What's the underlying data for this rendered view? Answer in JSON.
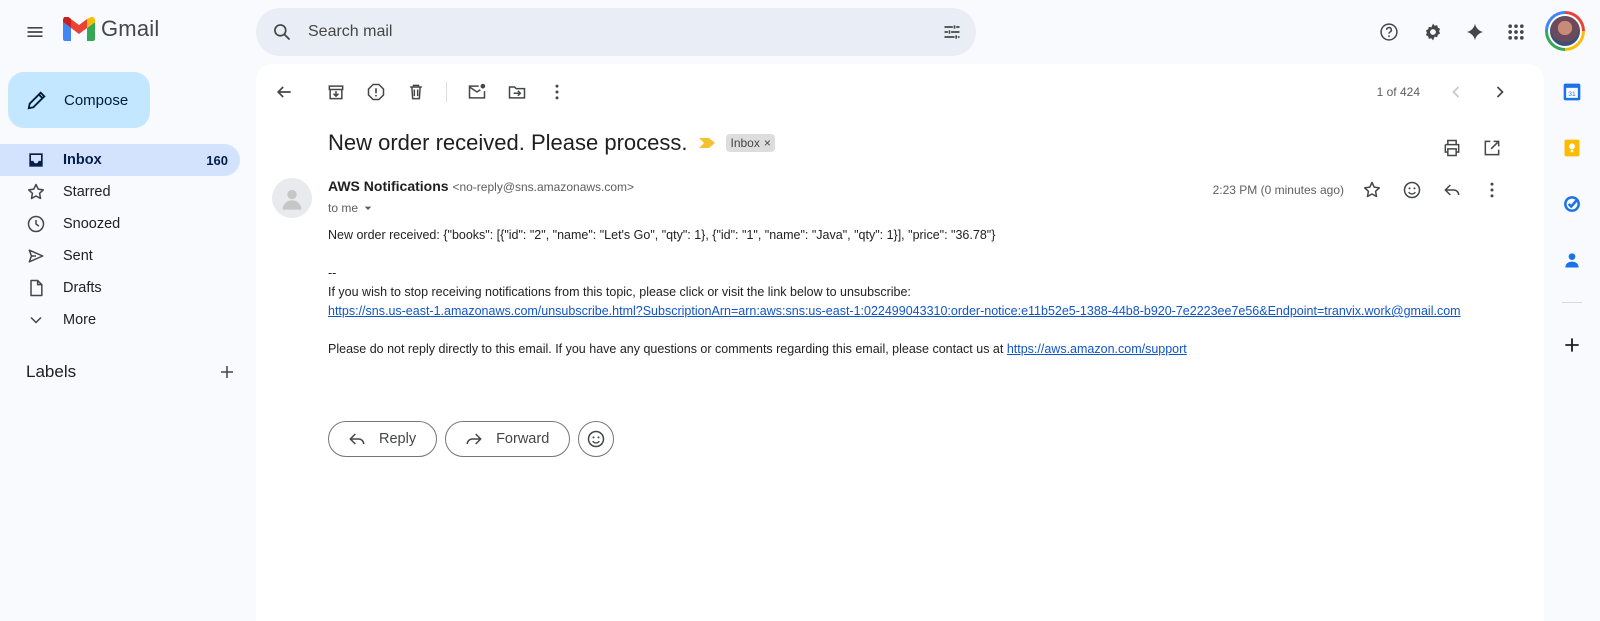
{
  "app": {
    "name": "Gmail"
  },
  "search": {
    "placeholder": "Search mail"
  },
  "compose": {
    "label": "Compose"
  },
  "nav": {
    "items": [
      {
        "label": "Inbox",
        "count": "160",
        "icon": "inbox-icon",
        "active": true
      },
      {
        "label": "Starred",
        "count": "",
        "icon": "star-icon"
      },
      {
        "label": "Snoozed",
        "count": "",
        "icon": "clock-icon"
      },
      {
        "label": "Sent",
        "count": "",
        "icon": "send-icon"
      },
      {
        "label": "Drafts",
        "count": "",
        "icon": "draft-icon"
      },
      {
        "label": "More",
        "count": "",
        "icon": "chevron-down-icon"
      }
    ]
  },
  "labels": {
    "title": "Labels"
  },
  "pager": {
    "text": "1 of 424"
  },
  "email": {
    "subject": "New order received. Please process.",
    "label_chip": "Inbox",
    "sender_name": "AWS Notifications",
    "sender_email": "<no-reply@sns.amazonaws.com>",
    "to": "to me",
    "time": "2:23 PM (0 minutes ago)",
    "body_line1": "New order received: {\"books\": [{\"id\": \"2\", \"name\": \"Let's Go\", \"qty\": 1}, {\"id\": \"1\", \"name\": \"Java\", \"qty\": 1}], \"price\": \"36.78\"}",
    "body_sig": "--",
    "body_unsub_text": "If you wish to stop receiving notifications from this topic, please click or visit the link below to unsubscribe:",
    "body_unsub_link": "https://sns.us-east-1.amazonaws.com/unsubscribe.html?SubscriptionArn=arn:aws:sns:us-east-1:022499043310:order-notice:e11b52e5-1388-44b8-b920-7e2223ee7e56&Endpoint=tranvix.work@gmail.com",
    "body_noreply_text": "Please do not reply directly to this email. If you have any questions or comments regarding this email, please contact us at ",
    "body_support_link": "https://aws.amazon.com/support"
  },
  "actions": {
    "reply": "Reply",
    "forward": "Forward"
  },
  "colors": {
    "accent": "#0b57d0",
    "compose_bg": "#c2e7ff",
    "active_nav": "#d3e3fd",
    "link": "#1155cc"
  }
}
